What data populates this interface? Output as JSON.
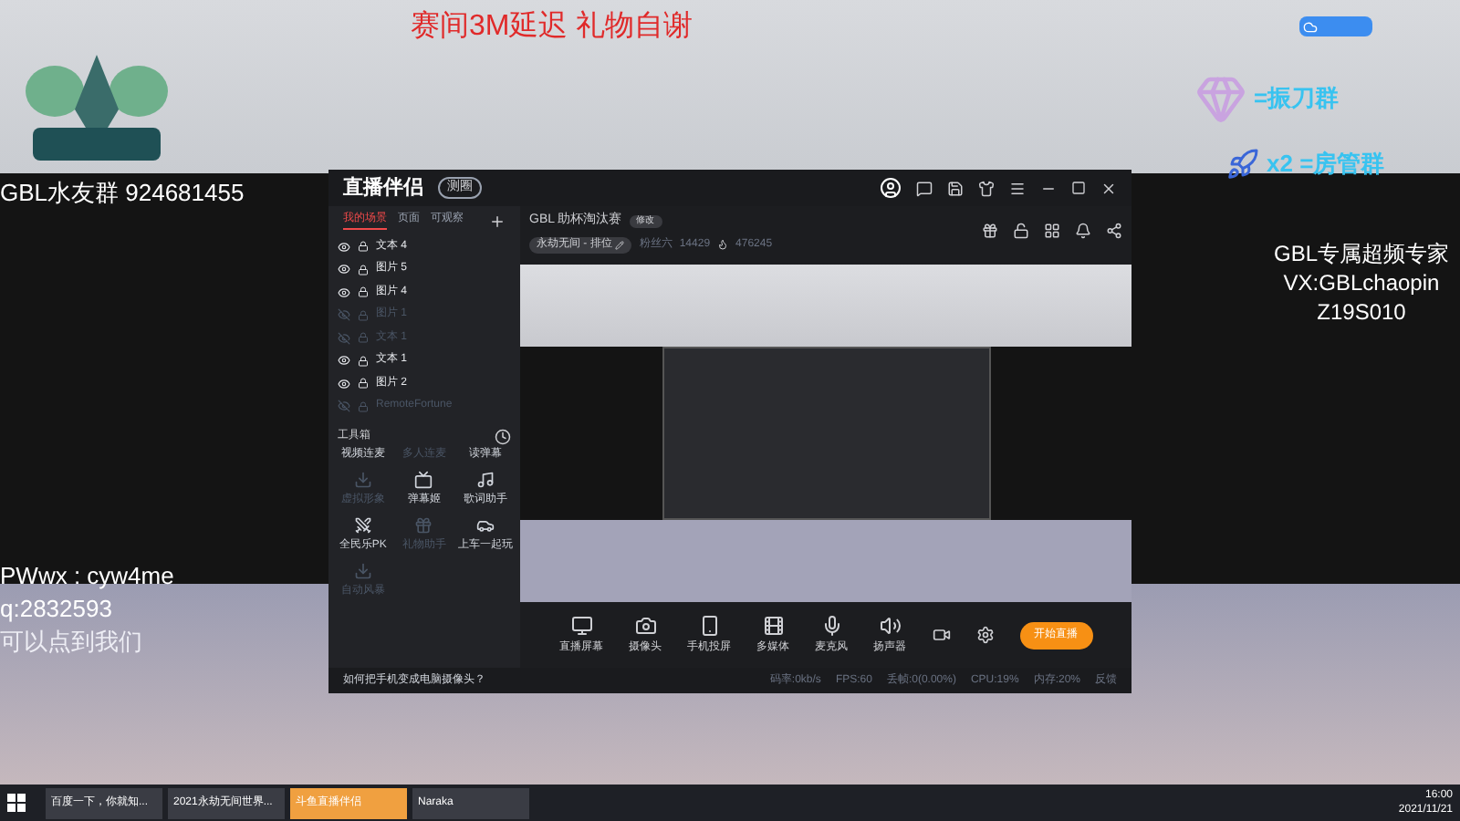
{
  "stream_overlay": {
    "notice": "赛间3M延迟 礼物自谢",
    "fan_group": "GBL水友群 924681455",
    "badges": [
      {
        "text": "=振刀群"
      },
      {
        "text": "x2 =房管群"
      }
    ],
    "sponsor": [
      "GBL专属超频专家",
      "VX:GBLchaopin",
      "Z19S010"
    ],
    "contact": [
      "PWwx : cyw4me",
      "q:2832593",
      "可以点到我们"
    ]
  },
  "window": {
    "title": "直播伴侣",
    "title_badge": "测圈",
    "tabs": [
      {
        "label": "我的场景",
        "selected": true
      },
      {
        "label": "页面",
        "selected": false
      },
      {
        "label": "可观察",
        "selected": false
      }
    ],
    "sources": [
      {
        "name": "文本 4",
        "visible": true
      },
      {
        "name": "图片 5",
        "visible": true
      },
      {
        "name": "图片 4",
        "visible": true
      },
      {
        "name": "图片 1",
        "visible": false
      },
      {
        "name": "文本 1",
        "visible": false
      },
      {
        "name": "文本 1",
        "visible": true
      },
      {
        "name": "图片 2",
        "visible": true
      },
      {
        "name": "RemoteFortune",
        "visible": false
      }
    ],
    "toolbox": {
      "title": "工具箱",
      "tools": [
        {
          "label": "视频连麦",
          "disabled": false
        },
        {
          "label": "多人连麦",
          "disabled": true
        },
        {
          "label": "读弹幕",
          "disabled": false
        },
        {
          "label": "虚拟形象",
          "disabled": true
        },
        {
          "label": "弹幕姬",
          "disabled": false
        },
        {
          "label": "歌词助手",
          "disabled": false
        },
        {
          "label": "全民乐PK",
          "disabled": false
        },
        {
          "label": "礼物助手",
          "disabled": true
        },
        {
          "label": "上车一起玩",
          "disabled": false
        },
        {
          "label": "自动风暴",
          "disabled": true
        }
      ]
    },
    "room": {
      "title": "GBL 助杯淘汰赛",
      "edit": "修改",
      "category": "永劫无间 - 排位",
      "followers_label": "粉丝六",
      "followers": "14429",
      "heat": "476245"
    },
    "controls": [
      {
        "label": "直播屏幕"
      },
      {
        "label": "摄像头"
      },
      {
        "label": "手机投屏"
      },
      {
        "label": "多媒体"
      },
      {
        "label": "麦克风"
      },
      {
        "label": "扬声器"
      }
    ],
    "start_button": "开始直播",
    "status_bar": {
      "tip": "如何把手机变成电脑摄像头？",
      "stats": [
        "码率:0kb/s",
        "FPS:60",
        "丢帧:0(0.00%)",
        "CPU:19%",
        "内存:20%",
        "反馈"
      ]
    }
  },
  "taskbar": {
    "apps": [
      {
        "label": "百度一下，你就知...",
        "selected": false
      },
      {
        "label": "2021永劫无间世界...",
        "selected": false
      },
      {
        "label": "斗鱼直播伴侣",
        "selected": true
      },
      {
        "label": "Naraka",
        "selected": false
      }
    ],
    "time": "16:00",
    "date": "2021/11/21"
  }
}
